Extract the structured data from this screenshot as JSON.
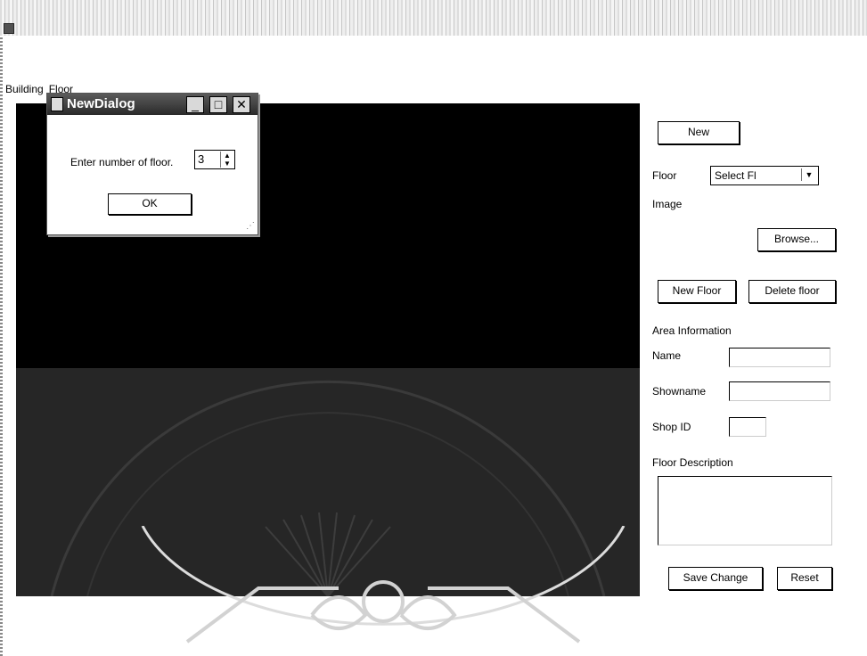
{
  "menu": {
    "items": [
      "Building",
      "Floor"
    ]
  },
  "dialog": {
    "title": "NewDialog",
    "prompt": "Enter number of floor.",
    "floor_count": "3",
    "ok_label": "OK",
    "minimize_glyph": "_",
    "maximize_glyph": "□",
    "close_glyph": "✕"
  },
  "panel": {
    "new_label": "New",
    "floor_label": "Floor",
    "floor_select_value": "Select Fl",
    "image_label": "Image",
    "browse_label": "Browse...",
    "new_floor_label": "New Floor",
    "delete_floor_label": "Delete floor",
    "area_info_label": "Area Information",
    "name_label": "Name",
    "showname_label": "Showname",
    "shop_id_label": "Shop ID",
    "floor_desc_label": "Floor Description",
    "save_label": "Save Change",
    "reset_label": "Reset"
  },
  "icons": {
    "dropdown": "chevron-down-icon",
    "spinner": "spinner-arrows-icon",
    "grip": "resize-grip-icon"
  }
}
